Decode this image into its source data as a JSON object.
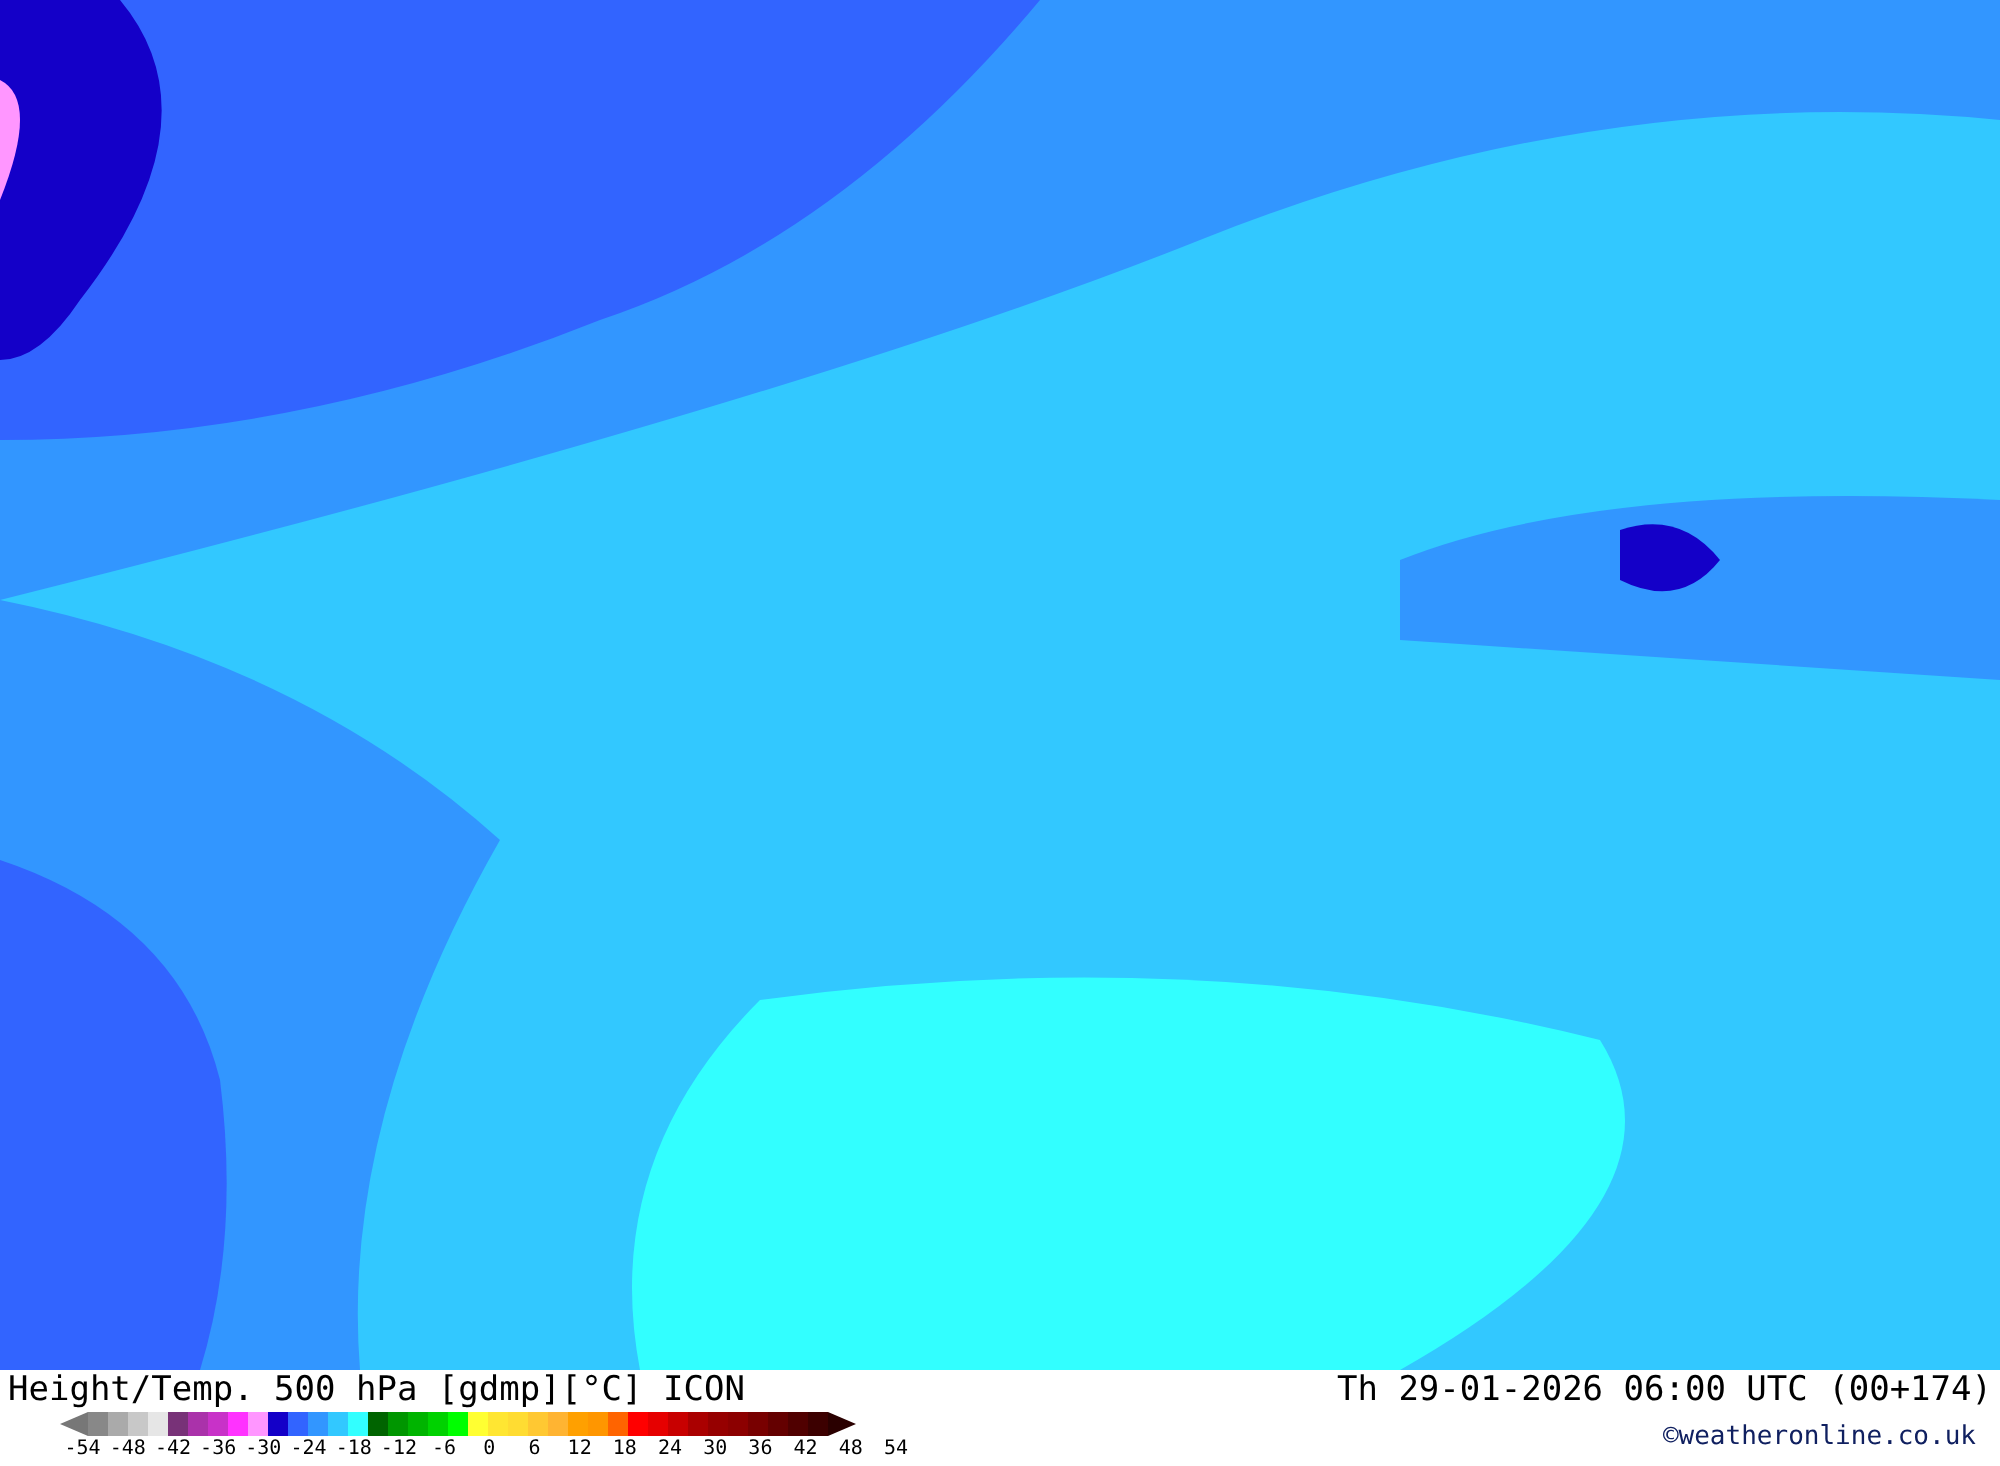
{
  "map": {
    "kind": "temperature-field"
  },
  "footer": {
    "title": "Height/Temp. 500 hPa [gdmp][°C] ICON",
    "valid_time": "Th 29-01-2026 06:00 UTC (00+174)",
    "copyright": "©weatheronline.co.uk"
  },
  "legend": {
    "swatches": [
      {
        "color": "#888888"
      },
      {
        "color": "#aaaaaa"
      },
      {
        "color": "#c8c8c8"
      },
      {
        "color": "#e6e6e6"
      },
      {
        "color": "#783278"
      },
      {
        "color": "#aa32aa"
      },
      {
        "color": "#c832c8"
      },
      {
        "color": "#ff32ff"
      },
      {
        "color": "#ff96ff"
      },
      {
        "color": "#1400c8"
      },
      {
        "color": "#3264ff"
      },
      {
        "color": "#3296ff"
      },
      {
        "color": "#32c8ff"
      },
      {
        "color": "#32ffff"
      },
      {
        "color": "#006400"
      },
      {
        "color": "#009600"
      },
      {
        "color": "#00b400"
      },
      {
        "color": "#00d200"
      },
      {
        "color": "#00ff00"
      },
      {
        "color": "#ffff32"
      },
      {
        "color": "#ffe632"
      },
      {
        "color": "#ffdc32"
      },
      {
        "color": "#ffc832"
      },
      {
        "color": "#ffb432"
      },
      {
        "color": "#ffa000"
      },
      {
        "color": "#ff9600"
      },
      {
        "color": "#ff6400"
      },
      {
        "color": "#ff0000"
      },
      {
        "color": "#e60000"
      },
      {
        "color": "#c80000"
      },
      {
        "color": "#aa0000"
      },
      {
        "color": "#960000"
      },
      {
        "color": "#8c0000"
      },
      {
        "color": "#780000"
      },
      {
        "color": "#640000"
      },
      {
        "color": "#500000"
      },
      {
        "color": "#3c0000"
      }
    ],
    "ticks": [
      "-54",
      "-48",
      "-42",
      "-36",
      "-30",
      "-24",
      "-18",
      "-12",
      "-6",
      "0",
      "6",
      "12",
      "18",
      "24",
      "30",
      "36",
      "42",
      "48",
      "54"
    ]
  }
}
